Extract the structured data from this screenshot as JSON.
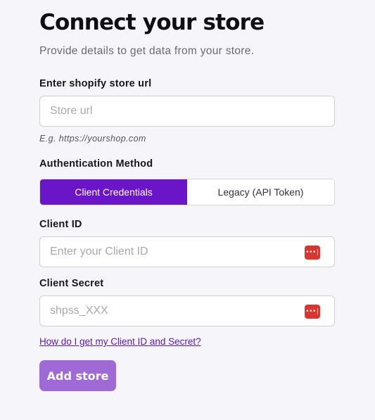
{
  "header": {
    "title": "Connect your store",
    "subtitle": "Provide details to get data from your store."
  },
  "store_url": {
    "label": "Enter shopify store url",
    "placeholder": "Store url",
    "value": "",
    "hint": "E.g. https://yourshop.com"
  },
  "auth": {
    "label": "Authentication Method",
    "options": [
      {
        "label": "Client Credentials",
        "selected": true
      },
      {
        "label": "Legacy (API Token)",
        "selected": false
      }
    ]
  },
  "client_id": {
    "label": "Client ID",
    "placeholder": "Enter your Client ID",
    "value": "",
    "icon": "password-manager-icon"
  },
  "client_secret": {
    "label": "Client Secret",
    "placeholder": "shpss_XXX",
    "value": "",
    "icon": "password-manager-icon"
  },
  "help_link": "How do I get my Client ID and Secret?",
  "submit_label": "Add store",
  "colors": {
    "accent": "#6b15c9",
    "submit": "#a06ad6",
    "link": "#5a17c4",
    "password_icon": "#d9362f",
    "background": "#f6f5f9"
  }
}
